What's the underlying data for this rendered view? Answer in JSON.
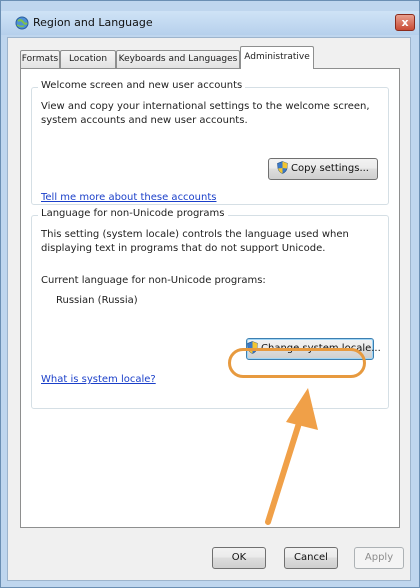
{
  "window": {
    "title": "Region and Language",
    "close_glyph": "x"
  },
  "tabs": [
    {
      "label": "Formats",
      "active": false
    },
    {
      "label": "Location",
      "active": false
    },
    {
      "label": "Keyboards and Languages",
      "active": false
    },
    {
      "label": "Administrative",
      "active": true
    }
  ],
  "welcome": {
    "title": "Welcome screen and new user accounts",
    "description": "View and copy your international settings to the welcome screen, system accounts and new user accounts.",
    "copy_button": "Copy settings...",
    "link": "Tell me more about these accounts"
  },
  "nonunicode": {
    "title": "Language for non-Unicode programs",
    "description": "This setting (system locale) controls the language used when displaying text in programs that do not support Unicode.",
    "current_label": "Current language for non-Unicode programs:",
    "current_value": "Russian (Russia)",
    "change_button": "Change system locale...",
    "link": "What is system locale?"
  },
  "footer": {
    "ok": "OK",
    "cancel": "Cancel",
    "apply": "Apply"
  },
  "colors": {
    "callout": "#e79a3f",
    "link": "#1a3fc9"
  }
}
